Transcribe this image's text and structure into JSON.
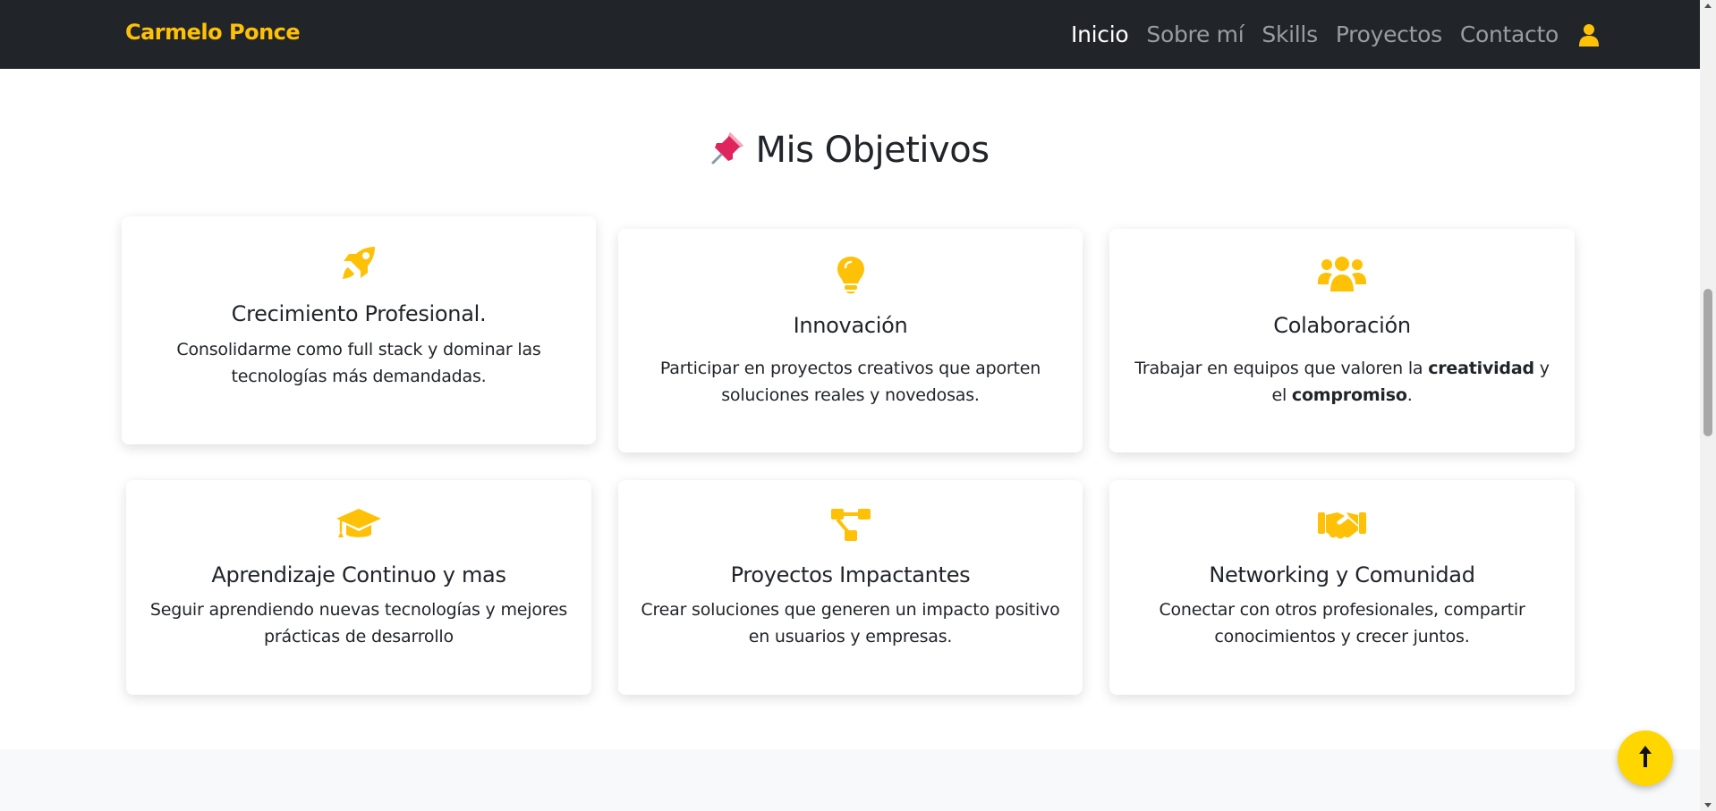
{
  "navbar": {
    "brand": "Carmelo Ponce",
    "links": [
      "Inicio",
      "Sobre mí",
      "Skills",
      "Proyectos",
      "Contacto"
    ],
    "active": "Inicio",
    "user_icon": "user-icon"
  },
  "section": {
    "title": "Mis Objetivos",
    "title_icon": "pushpin-icon"
  },
  "cards": [
    {
      "icon": "rocket-icon",
      "title": "Crecimiento Profesional.",
      "text": "Consolidarme como full stack y dominar las tecnologías más demandadas."
    },
    {
      "icon": "lightbulb-icon",
      "title": "Innovación",
      "text": "Participar en proyectos creativos que aporten soluciones reales y novedosas."
    },
    {
      "icon": "users-icon",
      "title": "Colaboración",
      "text_before": "Trabajar en equipos que valoren la",
      "text_bold_1": "creatividad",
      "text_mid": "y el",
      "text_bold_2": "compromiso",
      "text_after": "."
    },
    {
      "icon": "graduation-cap-icon",
      "title": "Aprendizaje Continuo y mas",
      "text": "Seguir aprendiendo nuevas tecnologías y mejores prácticas de desarrollo"
    },
    {
      "icon": "project-diagram-icon",
      "title": "Proyectos Impactantes",
      "text": "Crear soluciones que generen un impacto positivo en usuarios y empresas."
    },
    {
      "icon": "handshake-icon",
      "title": "Networking y Comunidad",
      "text": "Conectar con otros profesionales, compartir conocimientos y crecer juntos."
    }
  ],
  "scroll_top": {
    "icon": "arrow-up-icon"
  },
  "colors": {
    "accent": "#ffc107",
    "navbar_bg": "#212529",
    "scroll_button": "#ffd600"
  }
}
